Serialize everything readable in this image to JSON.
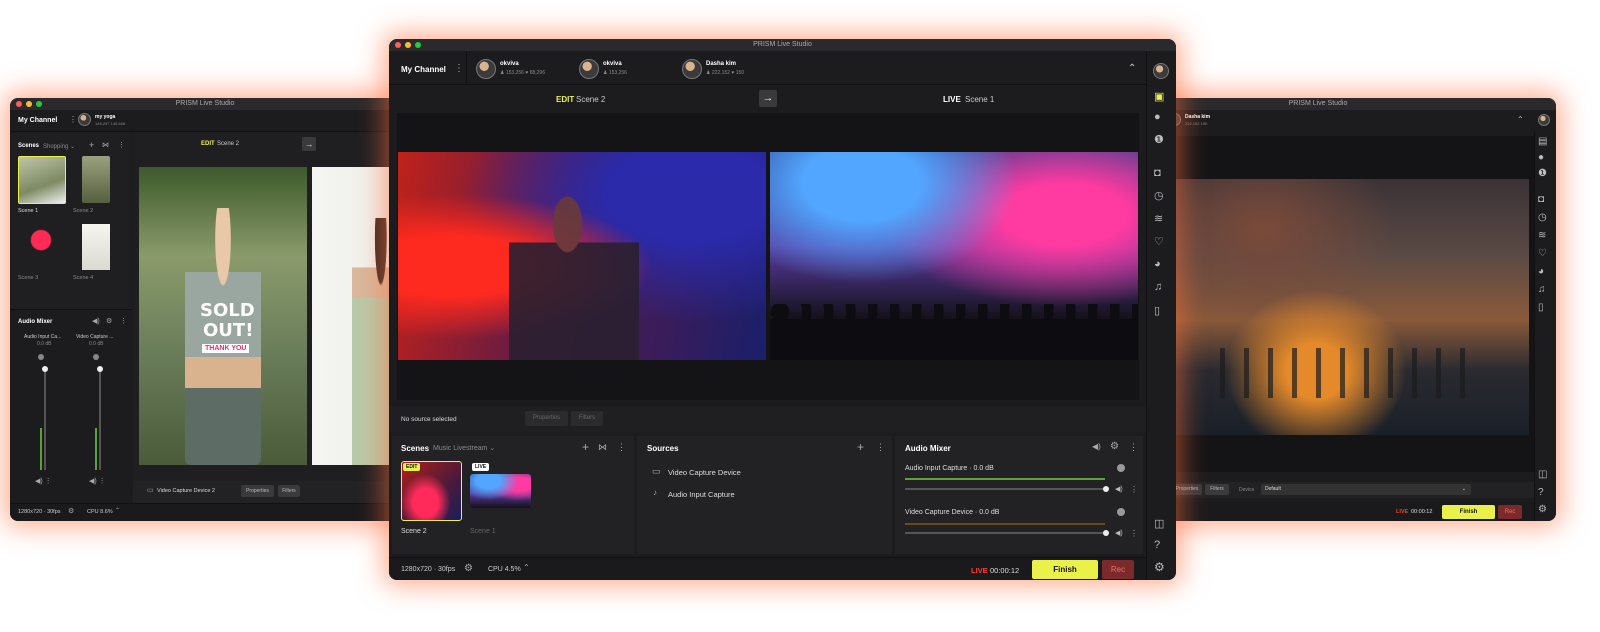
{
  "app": {
    "title": "PRISM Live Studio"
  },
  "main": {
    "channel_label": "My Channel",
    "channels": [
      {
        "name": "okviva",
        "followers": "153,256",
        "likes": "88,296"
      },
      {
        "name": "okviva",
        "followers": "153,256"
      },
      {
        "name": "Dasha kim",
        "followers": "222,152",
        "likes": "150"
      }
    ],
    "edit_tag": "EDIT",
    "edit_scene": "Scene 2",
    "live_tag": "LIVE",
    "live_scene": "Scene 1",
    "no_source": "No source selected",
    "properties_btn": "Properties",
    "filters_btn": "Filters",
    "scenes": {
      "title": "Scenes",
      "collection": "Music Livestream",
      "items": [
        {
          "label": "Scene 2",
          "badge": "EDIT"
        },
        {
          "label": "Scene 1",
          "badge": "LIVE"
        }
      ]
    },
    "sources": {
      "title": "Sources",
      "items": [
        "Video Capture Device",
        "Audio Input Capture"
      ]
    },
    "mixer": {
      "title": "Audio Mixer",
      "channels": [
        {
          "name": "Audio Input Capture",
          "db": "0.0 dB"
        },
        {
          "name": "Video Capture Device",
          "db": "0.0 dB"
        }
      ]
    },
    "status": {
      "resolution": "1280x720",
      "fps": "30fps",
      "cpu": "CPU 4.5%",
      "live_label": "LIVE",
      "time": "00:00:12",
      "finish": "Finish",
      "rec": "Rec"
    }
  },
  "left": {
    "channel_label": "My Channel",
    "channel": {
      "name": "my yoga",
      "followers": "148,257",
      "likes": "140,656"
    },
    "edit_tag": "EDIT",
    "edit_scene": "Scene 2",
    "scenes": {
      "title": "Scenes",
      "collection": "Shopping",
      "items": [
        "Scene 1",
        "Scene 2",
        "Scene 3",
        "Scene 4"
      ]
    },
    "mixer": {
      "title": "Audio Mixer",
      "channels": [
        {
          "name": "Audio Input Ca...",
          "db": "0.0 dB"
        },
        {
          "name": "Video Capture ...",
          "db": "0.0 dB"
        }
      ]
    },
    "overlay": {
      "line1": "SOLD",
      "line2": "OUT!",
      "line3": "THANK YOU"
    },
    "source_bar": {
      "device": "Video Capture Device 2",
      "properties": "Properties",
      "filters": "Filters"
    },
    "status": {
      "resolution": "1280x720",
      "fps": "30fps",
      "cpu": "CPU 8.6%"
    }
  },
  "right": {
    "channel": {
      "name": "Dasha kim",
      "followers": "222,152",
      "likes": "150"
    },
    "source_bar": {
      "properties": "Properties",
      "filters": "Filters",
      "device_label": "Device",
      "device_value": "Default"
    },
    "status": {
      "live_label": "LIVE",
      "time": "00:00:12",
      "finish": "Finish",
      "rec": "Rec"
    }
  },
  "colors": {
    "accent_yellow": "#eaf24a",
    "live_red": "#ff3b30",
    "rec_red": "#7a2a2a",
    "glow": "#ff7a4a"
  }
}
